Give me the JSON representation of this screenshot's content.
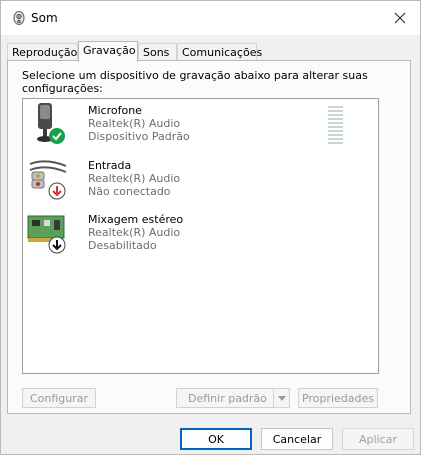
{
  "window": {
    "title": "Som",
    "icon": "speaker-icon"
  },
  "tabs": [
    {
      "label": "Reprodução",
      "active": false
    },
    {
      "label": "Gravação",
      "active": true
    },
    {
      "label": "Sons",
      "active": false
    },
    {
      "label": "Comunicações",
      "active": false
    }
  ],
  "instruction": "Selecione um dispositivo de gravação abaixo para alterar suas configurações:",
  "devices": [
    {
      "name": "Microfone",
      "driver": "Realtek(R) Audio",
      "status": "Dispositivo Padrão",
      "icon": "microphone-icon",
      "badge": "green-check-badge"
    },
    {
      "name": "Entrada",
      "driver": "Realtek(R) Audio",
      "status": "Não conectado",
      "icon": "audio-jack-icon",
      "badge": "red-down-arrow-badge"
    },
    {
      "name": "Mixagem estéreo",
      "driver": "Realtek(R) Audio",
      "status": "Desabilitado",
      "icon": "sound-card-icon",
      "badge": "black-down-arrow-badge"
    }
  ],
  "buttons": {
    "configure": "Configurar",
    "set_default": "Definir padrão",
    "properties": "Propriedades",
    "ok": "OK",
    "cancel": "Cancelar",
    "apply": "Aplicar"
  },
  "colors": {
    "accent": "#0067c0",
    "check_green": "#16a34a",
    "arrow_red": "#d13438"
  }
}
